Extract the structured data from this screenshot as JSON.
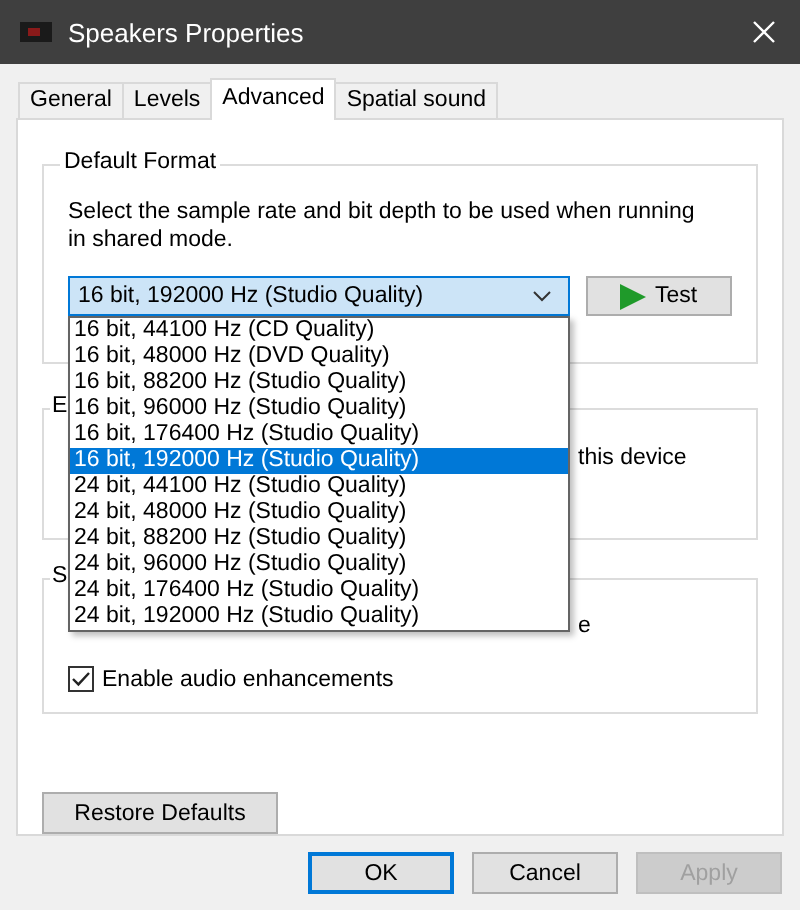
{
  "window": {
    "title": "Speakers Properties"
  },
  "tabs": [
    {
      "label": "General",
      "selected": false
    },
    {
      "label": "Levels",
      "selected": false
    },
    {
      "label": "Advanced",
      "selected": true
    },
    {
      "label": "Spatial sound",
      "selected": false
    }
  ],
  "default_format": {
    "title": "Default Format",
    "description": "Select the sample rate and bit depth to be used when running in shared mode.",
    "selected_format": "16 bit, 192000 Hz (Studio Quality)",
    "test_button": "Test",
    "dropdown": {
      "expanded": true,
      "options": [
        {
          "label": "16 bit, 44100 Hz (CD Quality)",
          "selected": false
        },
        {
          "label": "16 bit, 48000 Hz (DVD Quality)",
          "selected": false
        },
        {
          "label": "16 bit, 88200 Hz (Studio Quality)",
          "selected": false
        },
        {
          "label": "16 bit, 96000 Hz (Studio Quality)",
          "selected": false
        },
        {
          "label": "16 bit, 176400 Hz (Studio Quality)",
          "selected": false
        },
        {
          "label": "16 bit, 192000 Hz (Studio Quality)",
          "selected": true
        },
        {
          "label": "24 bit, 44100 Hz (Studio Quality)",
          "selected": false
        },
        {
          "label": "24 bit, 48000 Hz (Studio Quality)",
          "selected": false
        },
        {
          "label": "24 bit, 88200 Hz (Studio Quality)",
          "selected": false
        },
        {
          "label": "24 bit, 96000 Hz (Studio Quality)",
          "selected": false
        },
        {
          "label": "24 bit, 176400 Hz (Studio Quality)",
          "selected": false
        },
        {
          "label": "24 bit, 192000 Hz (Studio Quality)",
          "selected": false
        }
      ]
    }
  },
  "exclusive_mode": {
    "title_fragment": "E",
    "text_fragment": "this device"
  },
  "signal_enhancements": {
    "title_fragment": "S",
    "text_fragment": "e",
    "checkbox": {
      "label": "Enable audio enhancements",
      "checked": true
    }
  },
  "restore_button": "Restore Defaults",
  "buttons": [
    {
      "label": "OK",
      "kind": "default",
      "disabled": false
    },
    {
      "label": "Cancel",
      "kind": "normal",
      "disabled": false
    },
    {
      "label": "Apply",
      "kind": "normal",
      "disabled": true
    }
  ]
}
